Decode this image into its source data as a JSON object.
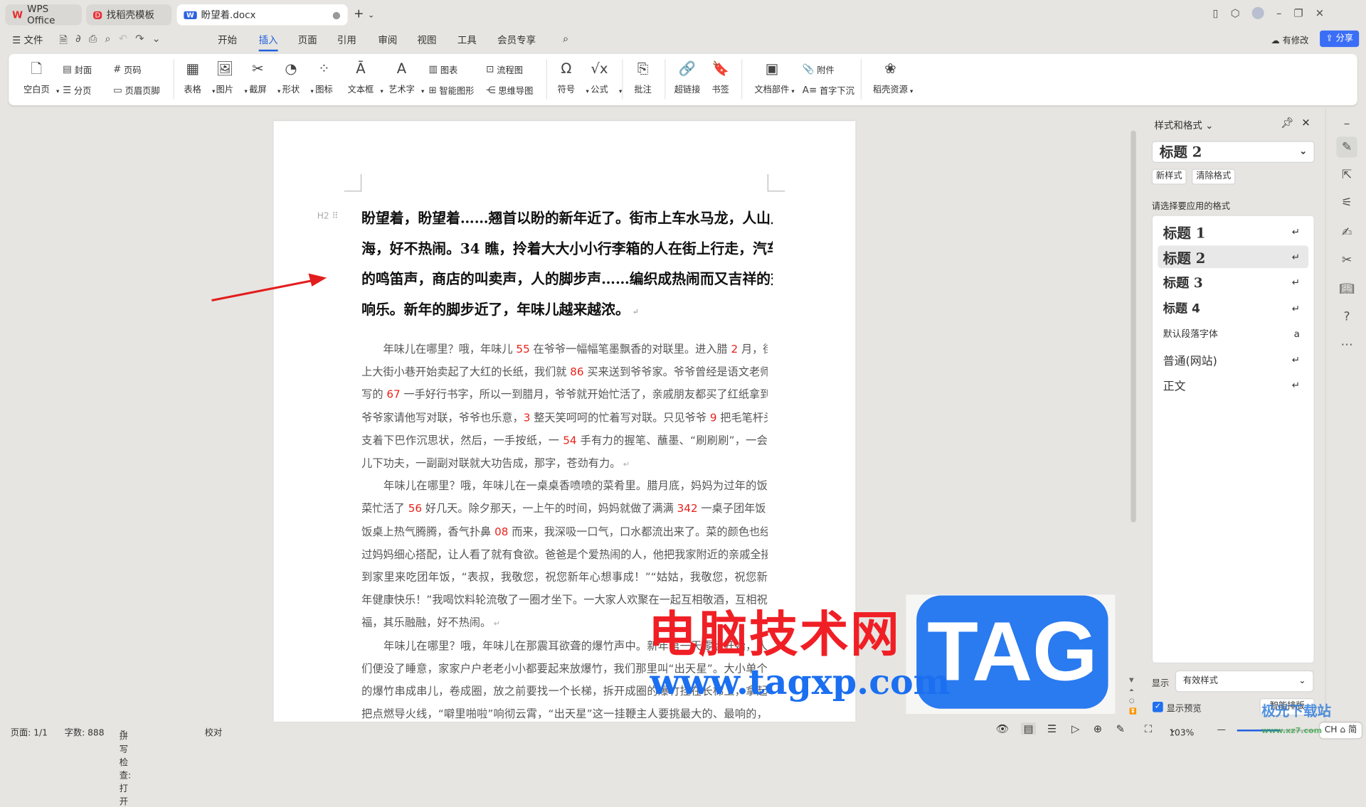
{
  "tabs": [
    {
      "label": "WPS Office"
    },
    {
      "label": "找稻壳模板"
    },
    {
      "label": "盼望着.docx"
    }
  ],
  "menubar": {
    "file": "文件",
    "items": [
      "开始",
      "插入",
      "页面",
      "引用",
      "审阅",
      "视图",
      "工具",
      "会员专享"
    ],
    "active": "插入",
    "modified": "有修改",
    "share": "分享"
  },
  "ribbon": {
    "big": [
      {
        "label": "空白页",
        "icon": "blank-page-icon",
        "g": "🗋"
      },
      {
        "label": "表格",
        "icon": "table-icon",
        "g": "▦"
      },
      {
        "label": "图片",
        "icon": "picture-icon",
        "g": "🖼"
      },
      {
        "label": "截屏",
        "icon": "screenshot-icon",
        "g": "✂"
      },
      {
        "label": "形状",
        "icon": "shape-icon",
        "g": "◔"
      },
      {
        "label": "图标",
        "icon": "icons-icon",
        "g": "⁘"
      },
      {
        "label": "文本框",
        "icon": "textbox-icon",
        "g": "Ā"
      },
      {
        "label": "艺术字",
        "icon": "wordart-icon",
        "g": "A"
      },
      {
        "label": "符号",
        "icon": "symbol-icon",
        "g": "Ω"
      },
      {
        "label": "公式",
        "icon": "formula-icon",
        "g": "√x"
      },
      {
        "label": "批注",
        "icon": "comment-icon",
        "g": "⎘"
      },
      {
        "label": "超链接",
        "icon": "hyperlink-icon",
        "g": "🔗"
      },
      {
        "label": "书签",
        "icon": "bookmark-icon",
        "g": "🔖"
      },
      {
        "label": "文档部件",
        "icon": "doc-parts-icon",
        "g": "▣"
      },
      {
        "label": "稻壳资源",
        "icon": "docer-resource-icon",
        "g": "❀"
      }
    ],
    "small": [
      {
        "label": "封面",
        "icon": "cover-icon",
        "g": "▤"
      },
      {
        "label": "分页",
        "icon": "page-break-icon",
        "g": "☰"
      },
      {
        "label": "页码",
        "icon": "page-number-icon",
        "g": "#"
      },
      {
        "label": "页眉页脚",
        "icon": "header-footer-icon",
        "g": "▭"
      },
      {
        "label": "图表",
        "icon": "chart-icon",
        "g": "▥"
      },
      {
        "label": "智能图形",
        "icon": "smart-art-icon",
        "g": "⊞"
      },
      {
        "label": "流程图",
        "icon": "flowchart-icon",
        "g": "⊡"
      },
      {
        "label": "思维导图",
        "icon": "mindmap-icon",
        "g": "⋲"
      },
      {
        "label": "附件",
        "icon": "attachment-icon",
        "g": "📎"
      },
      {
        "label": "首字下沉",
        "icon": "drop-cap-icon",
        "g": "A≡"
      }
    ]
  },
  "doc": {
    "heading_marker": "H2",
    "heading": [
      "盼望着，盼望着……翘首以盼的新年近了。街市上车水马龙，人山人",
      "海，好不热闹。34 瞧，拎着大大小小行李箱的人在街上行走，汽车",
      "的鸣笛声，商店的叫卖声，人的脚步声……编织成热闹而又吉祥的交",
      "响乐。新年的脚步近了，年味儿越来越浓。"
    ],
    "body": [
      [
        {
          "t": "　　年味儿在哪里？哦，年味儿 "
        },
        {
          "t": "55",
          "r": 1
        },
        {
          "t": " 在爷爷一幅幅笔墨飘香的对联里。进入腊 "
        },
        {
          "t": "2",
          "r": 1
        },
        {
          "t": " 月，街"
        }
      ],
      [
        {
          "t": "上大街小巷开始卖起了大红的长纸，我们就 "
        },
        {
          "t": "86",
          "r": 1
        },
        {
          "t": " 买来送到爷爷家。爷爷曾经是语文老师，"
        }
      ],
      [
        {
          "t": "写的 "
        },
        {
          "t": "67",
          "r": 1
        },
        {
          "t": " 一手好行书字，所以一到腊月，爷爷就开始忙活了，亲戚朋友都买了红纸拿到"
        }
      ],
      [
        {
          "t": "爷爷家请他写对联，爷爷也乐意，"
        },
        {
          "t": "3",
          "r": 1
        },
        {
          "t": " 整天笑呵呵的忙着写对联。只见爷爷 "
        },
        {
          "t": "9",
          "r": 1
        },
        {
          "t": " 把毛笔杆头"
        }
      ],
      [
        {
          "t": "支着下巴作沉思状，然后，一手按纸，一 "
        },
        {
          "t": "54",
          "r": 1
        },
        {
          "t": " 手有力的握笔、蘸墨、“刷刷刷”，一会"
        }
      ],
      [
        {
          "t": "儿下功夫，一副副对联就大功告成，那字，苍劲有力。"
        }
      ],
      [
        {
          "t": "　　年味儿在哪里？哦，年味儿在一桌桌香喷喷的菜肴里。腊月底，妈妈为过年的饭"
        }
      ],
      [
        {
          "t": "菜忙活了 "
        },
        {
          "t": "56",
          "r": 1
        },
        {
          "t": " 好几天。除夕那天，一上午的时间，妈妈就做了满满 "
        },
        {
          "t": "342",
          "r": 1
        },
        {
          "t": " 一桌子团年饭，"
        }
      ],
      [
        {
          "t": "饭桌上热气腾腾，香气扑鼻 "
        },
        {
          "t": "08",
          "r": 1
        },
        {
          "t": " 而来，我深吸一口气，口水都流出来了。菜的颜色也经"
        }
      ],
      [
        {
          "t": "过妈妈细心搭配，让人看了就有食欲。爸爸是个爱热闹的人，他把我家附近的亲戚全接"
        }
      ],
      [
        {
          "t": "到家里来吃团年饭，“表叔，我敬您，祝您新年心想事成！”“姑姑，我敬您，祝您新"
        }
      ],
      [
        {
          "t": "年健康快乐！”我喝饮料轮流敬了一圈才坐下。一大家人欢聚在一起互相敬酒，互相祝"
        }
      ],
      [
        {
          "t": "福，其乐融融，好不热闹。"
        }
      ],
      [
        {
          "t": "　　年味儿在哪里？哦，年味儿在那震耳欲聋的爆竹声中。新年第一天零点开始，人"
        }
      ],
      [
        {
          "t": "们便没了睡意，家家户户老老小小都要起来放爆竹，我们那里叫“出天星”。大小单个"
        }
      ],
      [
        {
          "t": "的爆竹串成串儿，卷成圈，放之前要找一个长梯，拆开成圈的爆竹挂在长梯上，拿起"
        }
      ],
      [
        {
          "t": "把点燃导火线，“噼里啪啦”响彻云霄，“出天星”这一挂鞭主人要挑最大的、最响的，"
        }
      ]
    ],
    "para_ends": [
      5,
      12
    ]
  },
  "panel": {
    "title": "样式和格式",
    "current": "标题 2",
    "new_style": "新样式",
    "clear_format": "清除格式",
    "prompt": "请选择要应用的格式",
    "styles": [
      {
        "label": "标题 1",
        "kind": "h1"
      },
      {
        "label": "标题 2",
        "kind": "h2",
        "selected": true
      },
      {
        "label": "标题 3",
        "kind": "h3"
      },
      {
        "label": "标题 4",
        "kind": "h4"
      },
      {
        "label": "默认段落字体",
        "kind": "char"
      },
      {
        "label": "普通(网站)",
        "kind": "p"
      },
      {
        "label": "正文",
        "kind": "p"
      }
    ],
    "show_label": "显示",
    "show_value": "有效样式",
    "preview_label": "显示预览",
    "preview_checked": true,
    "smart_layout": "智能排版"
  },
  "status": {
    "page": "页面: 1/1",
    "words": "字数: 888",
    "spell": "拼写检查: 打开",
    "proof": "校对",
    "zoom": "103%",
    "zoom_fraction": 0.55,
    "ime": "CH ⌂ 简"
  },
  "watermark": {
    "cn": "电脑技术网",
    "url": "www.tagxp.com",
    "logo": "TAG",
    "corner": "极光下载站",
    "corner_url": "www.xz7.com"
  },
  "colors": {
    "accent": "#1f5fe0",
    "red": "#e8221b",
    "share": "#3b6ef6"
  }
}
